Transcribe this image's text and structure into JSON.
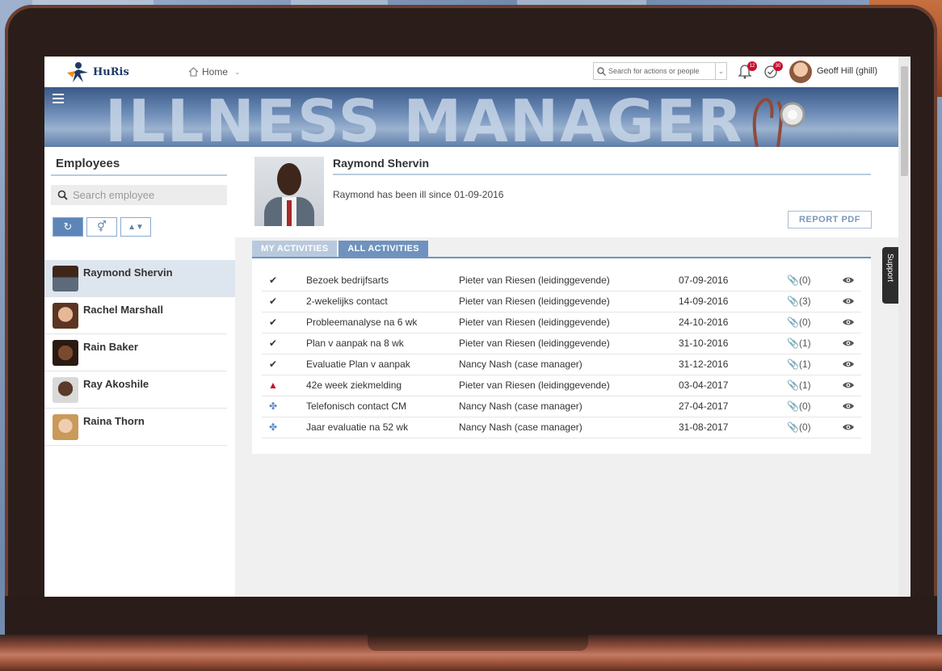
{
  "app": {
    "logo_text": "HuRis",
    "banner_title": "ILLNESS MANAGER"
  },
  "topbar": {
    "home_label": "Home",
    "search_placeholder": "Search for actions or people",
    "notification_count": "12",
    "tasks_count": "30",
    "user_name": "Geoff Hill (ghill)"
  },
  "sidebar": {
    "title": "Employees",
    "search_placeholder": "Search employee",
    "employees": [
      {
        "name": "Raymond Shervin",
        "selected": true
      },
      {
        "name": "Rachel Marshall",
        "selected": false
      },
      {
        "name": "Rain Baker",
        "selected": false
      },
      {
        "name": "Ray Akoshile",
        "selected": false
      },
      {
        "name": "Raina Thorn",
        "selected": false
      }
    ]
  },
  "profile": {
    "name": "Raymond Shervin",
    "status": "Raymond has been ill since 01-09-2016",
    "report_button": "REPORT PDF"
  },
  "tabs": [
    {
      "label": "MY ACTIVITIES",
      "active": false
    },
    {
      "label": "ALL ACTIVITIES",
      "active": true
    }
  ],
  "activities": [
    {
      "icon": "check-icon",
      "title": "Bezoek bedrijfsarts",
      "owner": "Pieter van Riesen (leidinggevende)",
      "date": "07-09-2016",
      "attachments": "(0)"
    },
    {
      "icon": "check-icon",
      "title": "2-wekelijks contact",
      "owner": "Pieter van Riesen (leidinggevende)",
      "date": "14-09-2016",
      "attachments": "(3)"
    },
    {
      "icon": "check-icon",
      "title": "Probleemanalyse na 6 wk",
      "owner": "Pieter van Riesen (leidinggevende)",
      "date": "24-10-2016",
      "attachments": "(0)"
    },
    {
      "icon": "check-icon",
      "title": "Plan v aanpak na 8 wk",
      "owner": "Pieter van Riesen (leidinggevende)",
      "date": "31-10-2016",
      "attachments": "(1)"
    },
    {
      "icon": "check-icon",
      "title": "Evaluatie Plan v aanpak",
      "owner": "Nancy Nash (case manager)",
      "date": "31-12-2016",
      "attachments": "(1)"
    },
    {
      "icon": "warning-icon",
      "title": "42e week ziekmelding",
      "owner": "Pieter van Riesen (leidinggevende)",
      "date": "03-04-2017",
      "attachments": "(1)"
    },
    {
      "icon": "target-icon",
      "title": "Telefonisch contact CM",
      "owner": "Nancy Nash (case manager)",
      "date": "27-04-2017",
      "attachments": "(0)"
    },
    {
      "icon": "target-icon",
      "title": "Jaar evaluatie na 52 wk",
      "owner": "Nancy Nash (case manager)",
      "date": "31-08-2017",
      "attachments": "(0)"
    }
  ],
  "support_label": "Support",
  "colors": {
    "accent": "#6f92be",
    "warning": "#c8102e",
    "brand": "#1f3a64"
  }
}
